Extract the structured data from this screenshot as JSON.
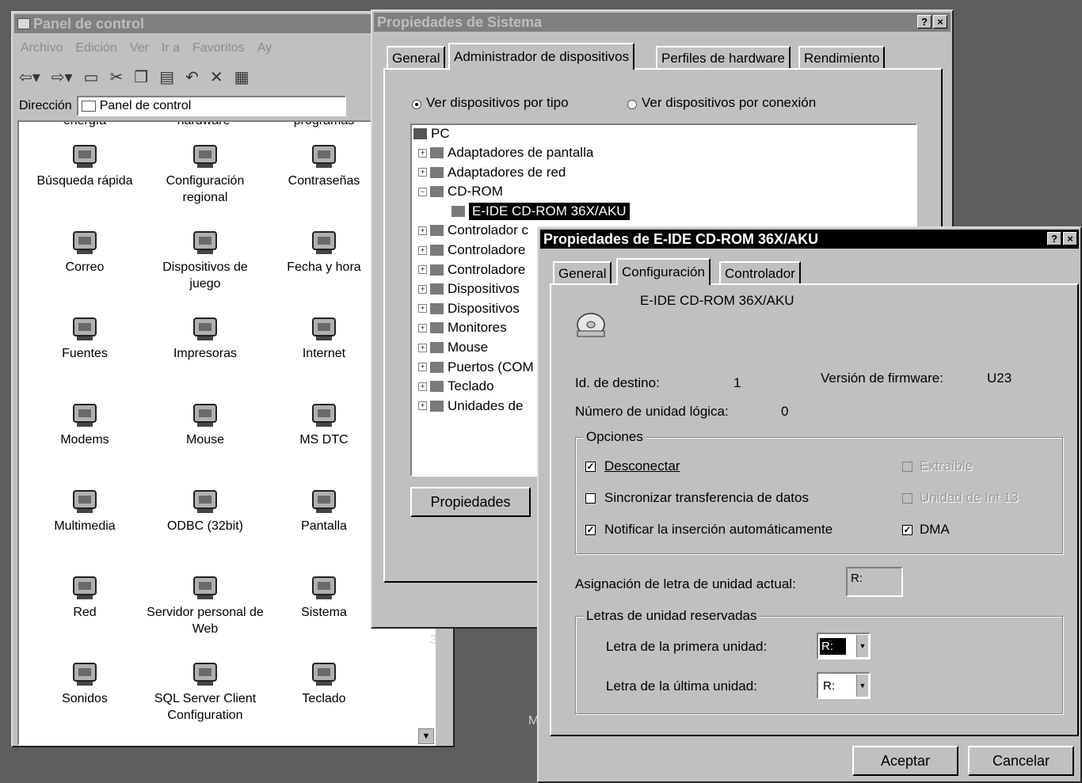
{
  "control_panel": {
    "title": "Panel de control",
    "menu": [
      "Archivo",
      "Edición",
      "Ver",
      "Ir a",
      "Favoritos",
      "Ay"
    ],
    "address_label": "Dirección",
    "address_value": "Panel de control",
    "partial_row": [
      "energía",
      "hardware",
      "programas"
    ],
    "items": [
      {
        "label": "Búsqueda rápida",
        "icon": "binoculars-icon"
      },
      {
        "label": "Configuración regional",
        "icon": "globe-icon"
      },
      {
        "label": "Contraseñas",
        "icon": "keys-icon"
      },
      {
        "label": "Correo",
        "icon": "mail-icon"
      },
      {
        "label": "Dispositivos de juego",
        "icon": "joystick-icon"
      },
      {
        "label": "Fecha y hora",
        "icon": "calendar-clock-icon"
      },
      {
        "label": "Fuentes",
        "icon": "fonts-folder-icon"
      },
      {
        "label": "Impresoras",
        "icon": "printer-folder-icon"
      },
      {
        "label": "Internet",
        "icon": "internet-icon"
      },
      {
        "label": "Modems",
        "icon": "phone-icon"
      },
      {
        "label": "Mouse",
        "icon": "mouse-icon"
      },
      {
        "label": "MS DTC",
        "icon": "network-tree-icon"
      },
      {
        "label": "Multimedia",
        "icon": "multimedia-icon"
      },
      {
        "label": "ODBC (32bit)",
        "icon": "odbc-icon"
      },
      {
        "label": "Pantalla",
        "icon": "display-icon"
      },
      {
        "label": "Red",
        "icon": "network-icon"
      },
      {
        "label": "Servidor personal de Web",
        "icon": "web-server-icon"
      },
      {
        "label": "Sistema",
        "icon": "computer-icon"
      },
      {
        "label": "Sonidos",
        "icon": "speaker-icon"
      },
      {
        "label": "SQL Server Client Configuration",
        "icon": "sql-icon"
      },
      {
        "label": "Teclado",
        "icon": "keyboard-icon"
      }
    ]
  },
  "system_properties": {
    "title": "Propiedades de Sistema",
    "help_btn": "?",
    "close_btn": "×",
    "tabs": [
      "General",
      "Administrador de dispositivos",
      "Perfiles de hardware",
      "Rendimiento"
    ],
    "radio_by_type": "Ver dispositivos por tipo",
    "radio_by_connection": "Ver dispositivos por conexión",
    "tree_root": "PC",
    "tree": [
      {
        "label": "Adaptadores de pantalla",
        "expander": "+"
      },
      {
        "label": "Adaptadores de red",
        "expander": "+"
      },
      {
        "label": "CD-ROM",
        "expander": "−"
      },
      {
        "label": "E-IDE CD-ROM 36X/AKU",
        "child": true
      },
      {
        "label": "Controlador c",
        "expander": "+"
      },
      {
        "label": "Controladore",
        "expander": "+"
      },
      {
        "label": "Controladore",
        "expander": "+"
      },
      {
        "label": "Dispositivos",
        "expander": "+"
      },
      {
        "label": "Dispositivos",
        "expander": "+"
      },
      {
        "label": "Monitores",
        "expander": "+"
      },
      {
        "label": "Mouse",
        "expander": "+"
      },
      {
        "label": "Puertos (COM",
        "expander": "+"
      },
      {
        "label": "Teclado",
        "expander": "+"
      },
      {
        "label": "Unidades de",
        "expander": "+"
      }
    ],
    "properties_button": "Propiedades"
  },
  "cdrom_dialog": {
    "title": "Propiedades de E-IDE CD-ROM 36X/AKU",
    "help_btn": "?",
    "close_btn": "×",
    "tabs": [
      "General",
      "Configuración",
      "Controlador"
    ],
    "device_name": "E-IDE CD-ROM 36X/AKU",
    "target_id_label": "Id. de destino:",
    "target_id_value": "1",
    "firmware_label": "Versión de firmware:",
    "firmware_value": "U23",
    "lun_label": "Número de unidad lógica:",
    "lun_value": "0",
    "options_title": "Opciones",
    "opt_disconnect": "Desconectar",
    "opt_sync": "Sincronizar transferencia de datos",
    "opt_autonotify": "Notificar la inserción automáticamente",
    "opt_removable": "Extraíble",
    "opt_int13": "Unidad de Int 13",
    "opt_dma": "DMA",
    "current_letter_label": "Asignación de letra de unidad actual:",
    "current_letter_value": "R:",
    "reserved_title": "Letras de unidad reservadas",
    "first_letter_label": "Letra de la primera unidad:",
    "first_letter_value": "R:",
    "last_letter_label": "Letra de la última unidad:",
    "last_letter_value": "R:",
    "ok_button": "Aceptar",
    "cancel_button": "Cancelar"
  },
  "desktop_fragments": [
    "3",
    "M"
  ]
}
